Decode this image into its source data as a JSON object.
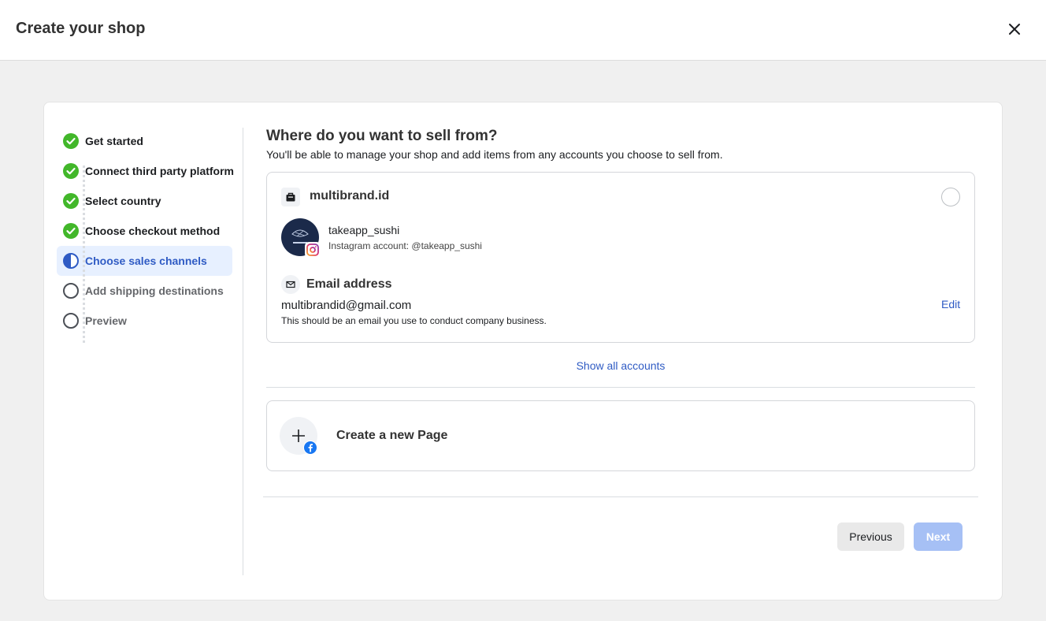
{
  "header": {
    "title": "Create your shop",
    "close_icon": "close-icon"
  },
  "steps": [
    {
      "label": "Get started",
      "status": "done"
    },
    {
      "label": "Connect third party platform",
      "status": "done"
    },
    {
      "label": "Select country",
      "status": "done"
    },
    {
      "label": "Choose checkout method",
      "status": "done"
    },
    {
      "label": "Choose sales channels",
      "status": "current"
    },
    {
      "label": "Add shipping destinations",
      "status": "todo"
    },
    {
      "label": "Preview",
      "status": "todo"
    }
  ],
  "main": {
    "heading": "Where do you want to sell from?",
    "subheading": "You'll be able to manage your shop and add items from any accounts you choose to sell from.",
    "account": {
      "page_name": "multibrand.id",
      "instagram_name": "takeapp_sushi",
      "instagram_sub": "Instagram account: @takeapp_sushi",
      "email_title": "Email address",
      "email_value": "multibrandid@gmail.com",
      "email_note": "This should be an email you use to conduct company business.",
      "edit_label": "Edit"
    },
    "show_all": "Show all accounts",
    "create_page": "Create a new Page"
  },
  "footer": {
    "previous": "Previous",
    "next": "Next"
  },
  "colors": {
    "accent": "#2f5bc4",
    "done": "#42b72a",
    "next_disabled": "#a6c0f5"
  }
}
